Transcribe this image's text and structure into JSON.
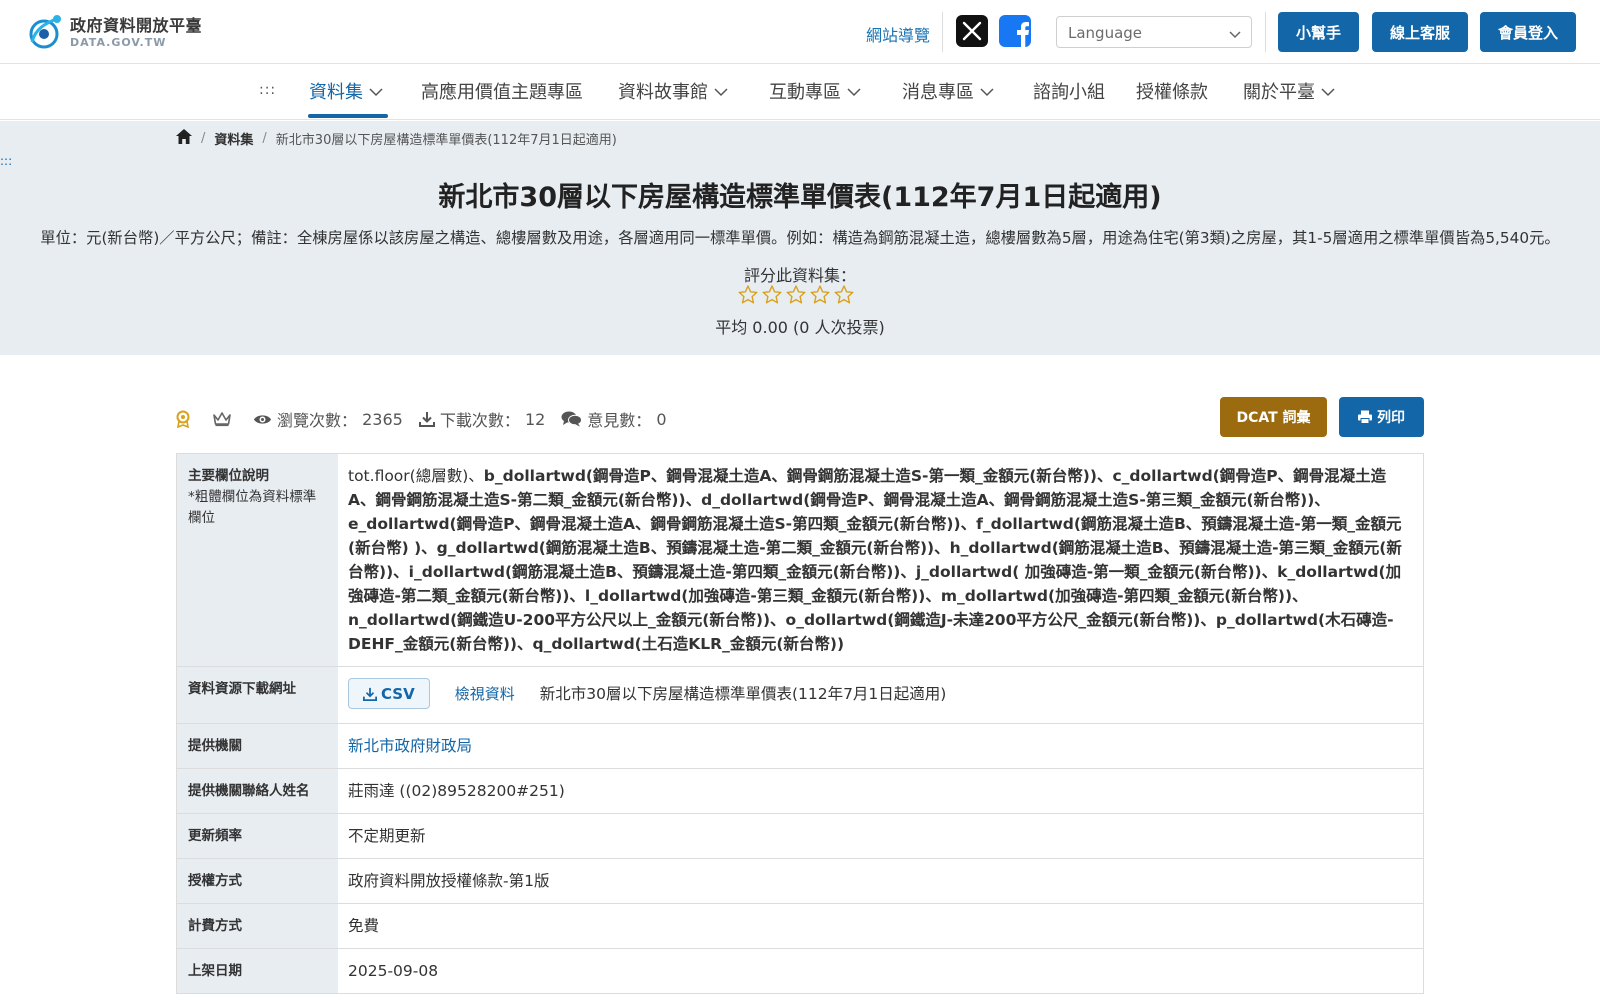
{
  "header": {
    "logo_zh": "政府資料開放平臺",
    "logo_en": "DATA.GOV.TW",
    "sitemap_label": "網站導覽",
    "language_placeholder": "Language",
    "buttons": {
      "helper": "小幫手",
      "support": "線上客服",
      "login": "會員登入"
    }
  },
  "nav": {
    "accessibility_marker": ":::",
    "items": [
      {
        "label": "資料集",
        "has_dropdown": true,
        "active": true
      },
      {
        "label": "高應用價值主題專區",
        "has_dropdown": false
      },
      {
        "label": "資料故事館",
        "has_dropdown": true
      },
      {
        "label": "互動專區",
        "has_dropdown": true
      },
      {
        "label": "消息專區",
        "has_dropdown": true
      },
      {
        "label": "諮詢小組",
        "has_dropdown": false
      },
      {
        "label": "授權條款",
        "has_dropdown": false
      },
      {
        "label": "關於平臺",
        "has_dropdown": true
      }
    ]
  },
  "breadcrumb": {
    "level1": "資料集",
    "current": "新北市30層以下房屋構造標準單價表(112年7月1日起適用)"
  },
  "banner": {
    "accessibility_marker": ":::",
    "title": "新北市30層以下房屋構造標準單價表(112年7月1日起適用)",
    "description": "單位：元(新台幣)／平方公尺；備註：全棟房屋係以該房屋之構造、總樓層數及用途，各層適用同一標準單價。例如：構造為鋼筋混凝土造，總樓層數為5層，用途為住宅(第3類)之房屋，其1-5層適用之標準單價皆為5,540元。",
    "rate_label": "評分此資料集：",
    "rating_value": 0,
    "rating_max": 5,
    "rate_average": "平均 0.00 (0 人次投票)"
  },
  "stats": {
    "views_label": "瀏覽次數：",
    "views": "2365",
    "downloads_label": "下載次數：",
    "downloads": "12",
    "comments_label": "意見數：",
    "comments": "0"
  },
  "actions": {
    "dcat": "DCAT 詞彙",
    "print": "列印"
  },
  "table": {
    "fields_label": "主要欄位說明",
    "fields_note": "*粗體欄位為資料標準欄位",
    "fields_plain": "tot.floor(總層數)、",
    "fields_bold": "b_dollartwd(鋼骨造P、鋼骨混凝土造A、鋼骨鋼筋混凝土造S-第一類_金額元(新台幣))、c_dollartwd(鋼骨造P、鋼骨混凝土造A、鋼骨鋼筋混凝土造S-第二類_金額元(新台幣))、d_dollartwd(鋼骨造P、鋼骨混凝土造A、鋼骨鋼筋混凝土造S-第三類_金額元(新台幣))、e_dollartwd(鋼骨造P、鋼骨混凝土造A、鋼骨鋼筋混凝土造S-第四類_金額元(新台幣))、f_dollartwd(鋼筋混凝土造B、預鑄混凝土造-第一類_金額元(新台幣) )、g_dollartwd(鋼筋混凝土造B、預鑄混凝土造-第二類_金額元(新台幣))、h_dollartwd(鋼筋混凝土造B、預鑄混凝土造-第三類_金額元(新台幣))、i_dollartwd(鋼筋混凝土造B、預鑄混凝土造-第四類_金額元(新台幣))、j_dollartwd( 加強磚造-第一類_金額元(新台幣))、k_dollartwd(加強磚造-第二類_金額元(新台幣))、l_dollartwd(加強磚造-第三類_金額元(新台幣))、m_dollartwd(加強磚造-第四類_金額元(新台幣))、n_dollartwd(鋼鐵造U-200平方公尺以上_金額元(新台幣))、o_dollartwd(鋼鐵造J-未達200平方公尺_金額元(新台幣))、p_dollartwd(木石磚造-DEHF_金額元(新台幣))、q_dollartwd(土石造KLR_金額元(新台幣))",
    "download_label": "資料資源下載網址",
    "csv_label": "CSV",
    "view_data_label": "檢視資料",
    "resource_name": "新北市30層以下房屋構造標準單價表(112年7月1日起適用)",
    "provider_label": "提供機關",
    "provider": "新北市政府財政局",
    "contact_label": "提供機關聯絡人姓名",
    "contact": "莊雨達 ((02)89528200#251)",
    "frequency_label": "更新頻率",
    "frequency": "不定期更新",
    "license_label": "授權方式",
    "license": "政府資料開放授權條款-第1版",
    "fee_label": "計費方式",
    "fee": "免費",
    "listed_label": "上架日期",
    "listed": "2025-09-08"
  },
  "colors": {
    "primary": "#1366a8",
    "dcat": "#9c6a0f",
    "banner_bg": "#e8edf2",
    "star": "#d9a21b"
  }
}
